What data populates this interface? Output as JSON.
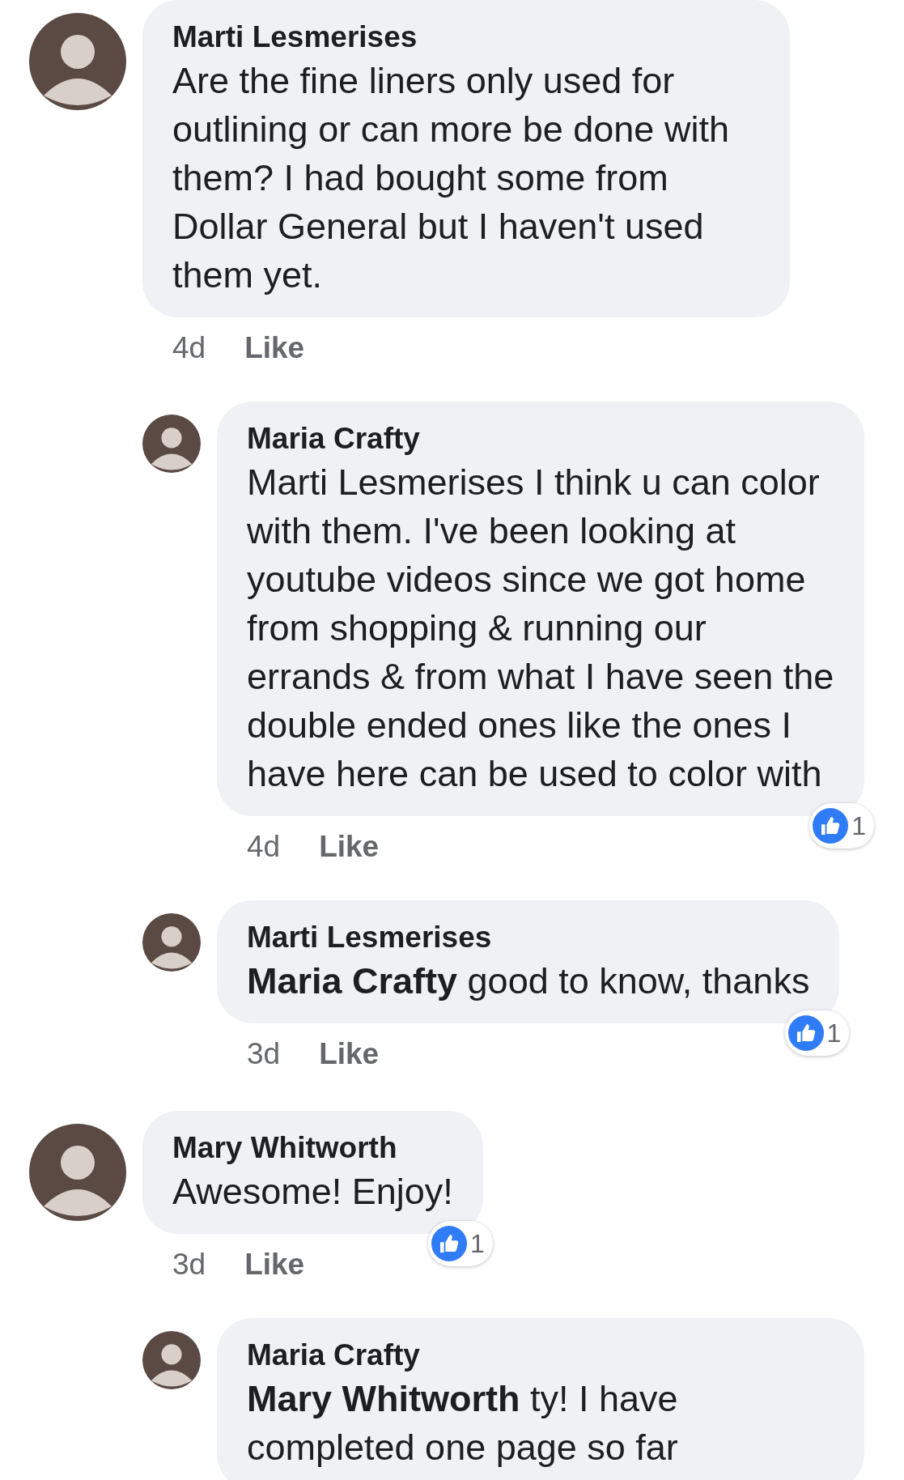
{
  "comments": [
    {
      "name": "Marti Lesmerises",
      "text": "Are the fine liners only used for outlining or can more be done with them? I had bought some from Dollar General but I haven't used them yet.",
      "time": "4d",
      "action": "Like",
      "children": [
        {
          "name": "Maria Crafty",
          "text": "Marti Lesmerises  I think u can color with them. I've been looking at youtube videos since we got home from shopping & running our errands & from what I have seen the double ended ones like the ones I have here can be used to color with",
          "time": "4d",
          "action": "Like",
          "reaction_count": "1"
        },
        {
          "name": "Marti Lesmerises",
          "text": "**Maria Crafty** good to know, thanks",
          "time": "3d",
          "action": "Like",
          "reaction_count": "1"
        }
      ]
    },
    {
      "name": "Mary Whitworth",
      "text": "Awesome!  Enjoy!",
      "time": "3d",
      "action": "Like",
      "reaction_count": "1",
      "children": [
        {
          "name": "Maria Crafty",
          "text": "**Mary Whitworth** ty! I have completed one page so far"
        }
      ]
    }
  ]
}
